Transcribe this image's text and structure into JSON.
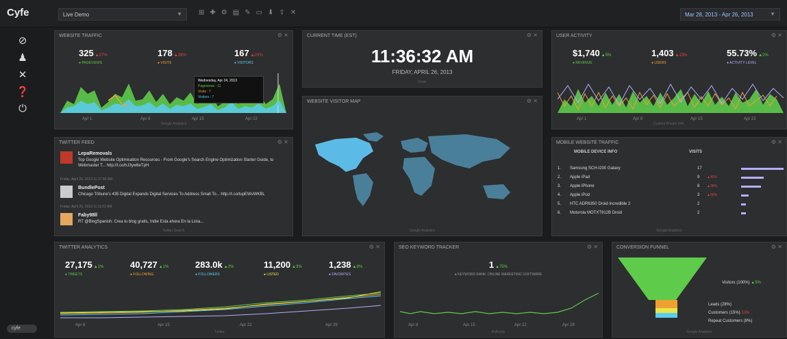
{
  "brand": "Cyfe",
  "dashboard_select": "Live Demo",
  "date_range": "Mar 28, 2013 - Apr 26, 2013",
  "cyfe_badge": "cyfe",
  "colors": {
    "bg": "#1b1c1e",
    "panel": "#2d2e30",
    "green": "#5ecb4a",
    "red": "#e0463d",
    "orange": "#f0a030",
    "lavender": "#b3b0ff",
    "cyan": "#5ccbf0"
  },
  "sidebar": [
    {
      "icon": "dashboard-icon",
      "glyph": "⊘"
    },
    {
      "icon": "user-icon",
      "glyph": "♟"
    },
    {
      "icon": "tools-icon",
      "glyph": "✕"
    },
    {
      "icon": "help-icon",
      "glyph": "❓"
    },
    {
      "icon": "power-icon",
      "glyph": "⏻"
    }
  ],
  "website_traffic": {
    "title": "WEBSITE TRAFFIC",
    "metrics": [
      {
        "value": "325",
        "change": "▲27%",
        "label": "● PAGEVIEWS"
      },
      {
        "value": "178",
        "change": "▲28%",
        "label": "● VISITS"
      },
      {
        "value": "167",
        "change": "▲23%",
        "label": "● VISITORS"
      }
    ],
    "xticks": [
      "Apr 1",
      "Apr 8",
      "Apr 15",
      "Apr 22"
    ],
    "footer": "Google Analytics",
    "tooltip": {
      "date": "Wednesday, Apr 24, 2013",
      "pageviews": "Pageviews : 11",
      "visits": "Visits : 7",
      "visitors": "Visitors : 7"
    }
  },
  "current_time": {
    "title": "CURRENT TIME (EST)",
    "time": "11:36:32 AM",
    "date": "FRIDAY, APRIL 26, 2013",
    "footer": "Clock"
  },
  "user_activity": {
    "title": "USER ACTIVITY",
    "metrics": [
      {
        "value": "$1,740",
        "change": "▲5%",
        "label": "● REVENUE"
      },
      {
        "value": "1,403",
        "change": "▲13%",
        "label": "● USERS"
      },
      {
        "value": "55.73%",
        "change": "▲2%",
        "label": "● ACTIVITY LEVEL"
      }
    ],
    "xticks": [
      "Apr 1",
      "Apr 8",
      "Apr 15",
      "Apr 22"
    ],
    "footer": "Custom Private URL"
  },
  "visitor_map": {
    "title": "WEBSITE VISITOR MAP",
    "footer": "Google Analytics"
  },
  "twitter_feed": {
    "title": "TWITTER FEED",
    "footer": "Twitter Search",
    "tweets": [
      {
        "name": "LepaRemovals",
        "text": "Top Google Website Optimisation Resources - From Google's Search Engine Optimization Starter Guide, to Webmaster T... http://t.co/hJ3yw6eTpH",
        "time": "Friday, April 26, 2013 11:17:00 AM"
      },
      {
        "name": "BundlePost",
        "text": "Chicago Tribune's 435 Digital Expands Digital Services To Address Small To... http://t.co/tupEWvWKBL",
        "time": "Friday, April 26, 2013 11:11:02 AM"
      },
      {
        "name": "Faby98ll",
        "text": "RT @BlogSpanish: Crea tu blog gratis, Indie Esta ahora En la Lista...",
        "time": ""
      }
    ]
  },
  "mobile_traffic": {
    "title": "MOBILE WEBSITE TRAFFIC",
    "col_device": "MOBILE DEVICE INFO",
    "col_visits": "VISITS",
    "footer": "Google Analytics",
    "rows": [
      {
        "rank": "1.",
        "device": "Samsung SCH-I200 Galaxy",
        "visits": "17",
        "change": "",
        "bar": 1.0
      },
      {
        "rank": "2.",
        "device": "Apple iPad",
        "visits": "9",
        "change": "▲40%",
        "bar": 0.53
      },
      {
        "rank": "3.",
        "device": "Apple iPhone",
        "visits": "8",
        "change": "▲38%",
        "bar": 0.47
      },
      {
        "rank": "4.",
        "device": "Apple iPod",
        "visits": "3",
        "change": "▲50%",
        "bar": 0.18
      },
      {
        "rank": "5.",
        "device": "HTC ADR6350 Droid Incredible 2",
        "visits": "2",
        "change": "",
        "bar": 0.12
      },
      {
        "rank": "6.",
        "device": "Motorola MOTXT912B Droid",
        "visits": "2",
        "change": "",
        "bar": 0.12
      }
    ]
  },
  "twitter_analytics": {
    "title": "TWITTER ANALYTICS",
    "metrics": [
      {
        "value": "27,175",
        "change": "▲1%",
        "label": "● TWEETS"
      },
      {
        "value": "40,727",
        "change": "▲1%",
        "label": "● FOLLOWING"
      },
      {
        "value": "283.0k",
        "change": "▲2%",
        "label": "● FOLLOWERS"
      },
      {
        "value": "11,200",
        "change": "▲3%",
        "label": "● LISTED"
      },
      {
        "value": "1,238",
        "change": "▲9%",
        "label": "● FAVORITES"
      }
    ],
    "xticks": [
      "Apr 8",
      "Apr 15",
      "Apr 22",
      "Apr 29"
    ],
    "footer": "Twitter"
  },
  "seo_tracker": {
    "title": "SEO KEYWORD TRACKER",
    "value": "1",
    "change": "▲75%",
    "label": "● KEYWORD RANK: ONLINE MARKETING SOFTWARE",
    "xticks": [
      "Apr 8",
      "Apr 15",
      "Apr 22",
      "Apr 29"
    ],
    "footer": "Authority"
  },
  "conversion_funnel": {
    "title": "CONVERSION FUNNEL",
    "visitors": "Visitors (100%)",
    "visitors_change": "▲5%",
    "leads": "Leads (28%)",
    "customers": "Customers (15%)",
    "customers_change": "13%",
    "repeat": "Repeat Customers (8%)",
    "footer": "Google Analytics"
  }
}
